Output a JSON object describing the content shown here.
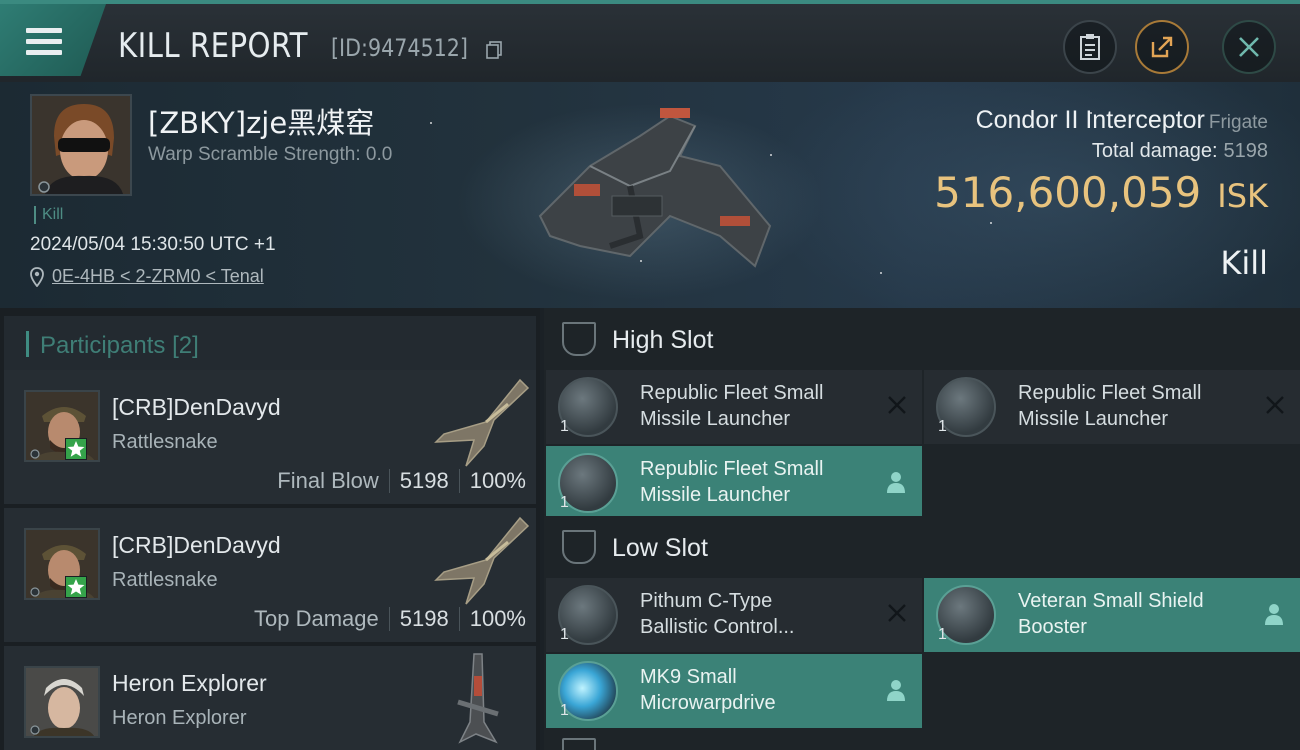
{
  "header": {
    "title": "KILL REPORT",
    "report_id": "[ID:9474512]"
  },
  "victim": {
    "name": "[ZBKY]zje黑煤窑",
    "warp_scramble": "Warp Scramble Strength: 0.0",
    "tag": "Kill",
    "datetime": "2024/05/04 15:30:50 UTC +1",
    "location": "0E-4HB < 2-ZRM0 < Tenal",
    "ship": "Condor II Interceptor",
    "ship_class": "Frigate",
    "total_damage_label": "Total damage:",
    "total_damage": "5198",
    "isk_value": "516,600,059",
    "isk_unit": "ISK",
    "result": "Kill"
  },
  "participants": {
    "label": "Participants",
    "count": "[2]",
    "rows": [
      {
        "name": "[CRB]DenDavyd",
        "ship": "Rattlesnake",
        "role": "Final Blow",
        "damage": "5198",
        "percent": "100%"
      },
      {
        "name": "[CRB]DenDavyd",
        "ship": "Rattlesnake",
        "role": "Top Damage",
        "damage": "5198",
        "percent": "100%"
      },
      {
        "name": "Heron Explorer",
        "ship": "Heron Explorer"
      }
    ]
  },
  "slots": {
    "high": {
      "label": "High Slot",
      "modules": [
        {
          "name": "Republic Fleet Small Missile Launcher",
          "line1": "Republic Fleet Small",
          "line2": "Missile Launcher",
          "qty": "1",
          "status": "destroyed"
        },
        {
          "name": "Republic Fleet Small Missile Launcher",
          "line1": "Republic Fleet Small",
          "line2": "Missile Launcher",
          "qty": "1",
          "status": "destroyed"
        },
        {
          "name": "Republic Fleet Small Missile Launcher",
          "line1": "Republic Fleet Small",
          "line2": "Missile Launcher",
          "qty": "1",
          "status": "dropped"
        }
      ]
    },
    "low": {
      "label": "Low Slot",
      "modules": [
        {
          "line1": "Pithum C-Type",
          "line2": "Ballistic Control...",
          "qty": "1",
          "status": "destroyed"
        },
        {
          "line1": "Veteran Small Shield",
          "line2": "Booster",
          "qty": "1",
          "status": "dropped"
        },
        {
          "line1": "MK9 Small",
          "line2": "Microwarpdrive",
          "qty": "1",
          "status": "dropped"
        }
      ]
    }
  },
  "colors": {
    "accent_teal": "#3b8277",
    "isk_gold": "#e8c37e",
    "badge_green": "#35a34a"
  }
}
